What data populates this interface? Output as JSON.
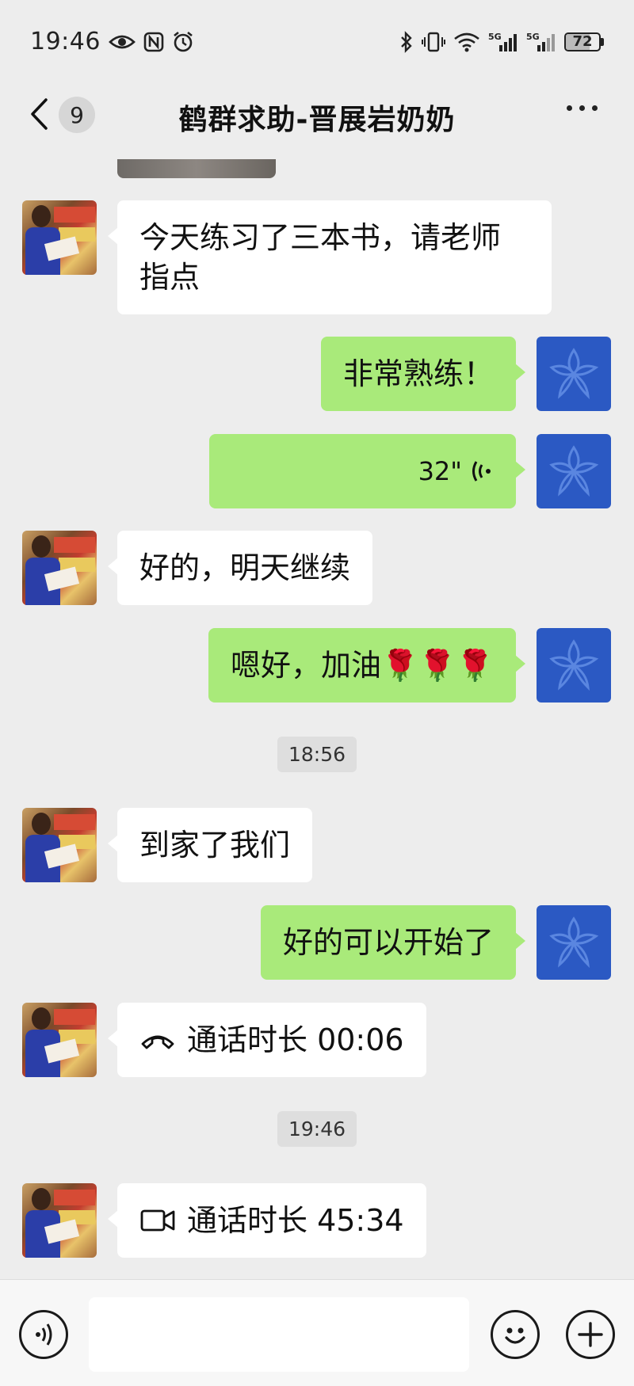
{
  "status_bar": {
    "time": "19:46",
    "battery": "72",
    "battery_level_percent": 72,
    "network_1": "5G",
    "network_2": "5G"
  },
  "header": {
    "unread_count": "9",
    "title": "鹤群求助-晋展岩奶奶"
  },
  "messages": [
    {
      "side": "left",
      "type": "text",
      "text": "今天练习了三本书，请老师\n指点"
    },
    {
      "side": "right",
      "type": "text",
      "text": "非常熟练！"
    },
    {
      "side": "right",
      "type": "voice",
      "duration": "32\""
    },
    {
      "side": "left",
      "type": "text",
      "text": "好的，明天继续"
    },
    {
      "side": "right",
      "type": "text",
      "text": "嗯好，加油🌹🌹🌹"
    },
    {
      "type": "timestamp",
      "text": "18:56"
    },
    {
      "side": "left",
      "type": "text",
      "text": "到家了我们"
    },
    {
      "side": "right",
      "type": "text",
      "text": "好的可以开始了"
    },
    {
      "side": "left",
      "type": "call",
      "call_kind": "voice",
      "text": "通话时长 00:06"
    },
    {
      "type": "timestamp",
      "text": "19:46"
    },
    {
      "side": "left",
      "type": "call",
      "call_kind": "video",
      "text": "通话时长 45:34"
    }
  ],
  "colors": {
    "background": "#ededed",
    "sent_bubble": "#a9ea7a",
    "received_bubble": "#ffffff",
    "teacher_avatar": "#2b59c3"
  },
  "icons": {
    "back": "chevron-left-icon",
    "more": "more-dots-icon",
    "voice_input": "voice-input-icon",
    "emoji": "emoji-icon",
    "add": "plus-icon",
    "voice_call": "phone-hangup-icon",
    "video_call": "video-camera-icon"
  }
}
